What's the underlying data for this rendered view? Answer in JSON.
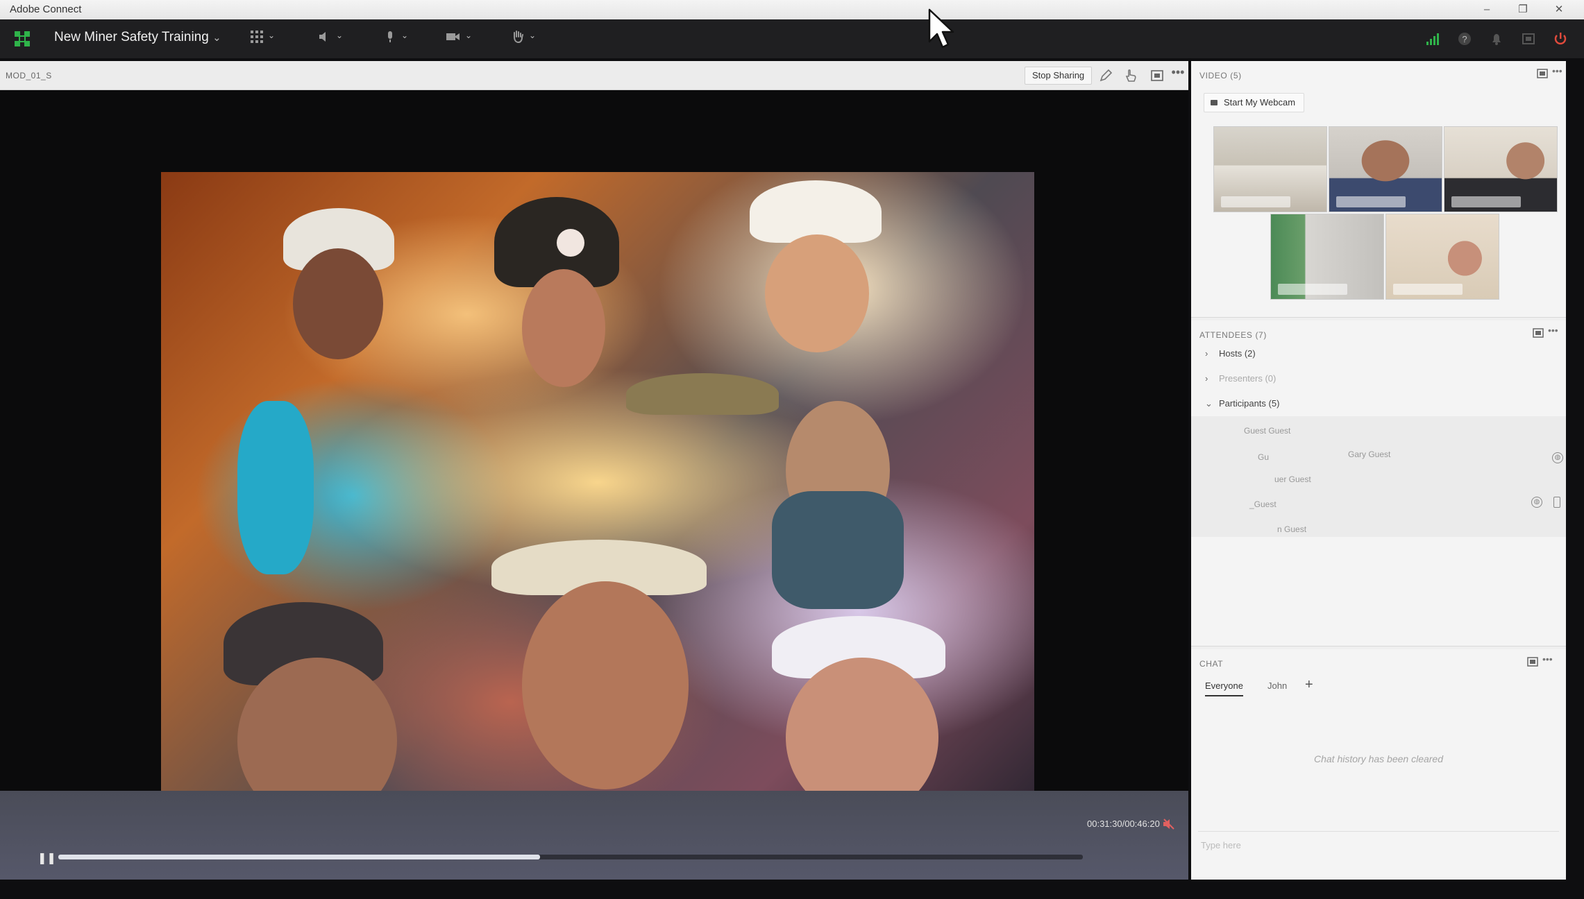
{
  "window": {
    "title": "Adobe Connect",
    "minimize_glyph": "–",
    "restore_glyph": "❐",
    "close_glyph": "✕"
  },
  "appbar": {
    "meeting_name": "New Miner Safety Training",
    "meeting_chevron": "⌄",
    "tools": [
      "apps-grid-icon",
      "speaker-icon",
      "microphone-icon",
      "camera-icon",
      "raise-hand-icon"
    ],
    "right_icons": [
      "connection-signal-icon",
      "help-icon",
      "notifications-icon",
      "fullscreen-icon",
      "power-icon"
    ],
    "accent_green": "#2fb34a",
    "power_red": "#e04a3c"
  },
  "share_pod": {
    "title": "MOD_01_S",
    "stop_sharing_label": "Stop Sharing"
  },
  "playback": {
    "time": "00:31:30/00:46:20",
    "progress": 0.47
  },
  "video_pod": {
    "title": "VIDEO (5)",
    "start_webcam_label": "Start My Webcam"
  },
  "attendees_pod": {
    "title": "ATTENDEES (7)",
    "groups": [
      {
        "label": "Hosts (2)",
        "expanded": false
      },
      {
        "label": "Presenters (0)",
        "expanded": false
      },
      {
        "label": "Participants (5)",
        "expanded": true
      }
    ],
    "participants": [
      "Guest Guest",
      "Gu",
      "Gary Guest",
      "uer Guest",
      "_Guest",
      "n Guest"
    ]
  },
  "chat_pod": {
    "title": "CHAT",
    "tabs": [
      "Everyone",
      "John"
    ],
    "add_tab": "+",
    "history_message": "Chat history has been cleared",
    "input_placeholder": "Type here"
  }
}
